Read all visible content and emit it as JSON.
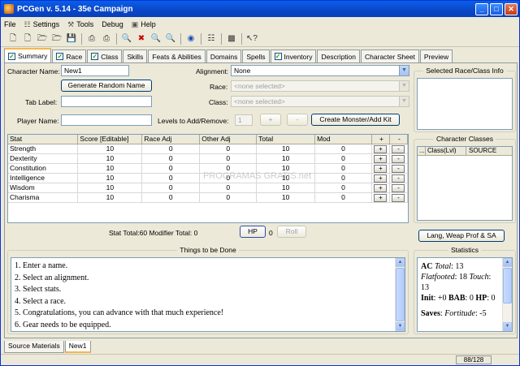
{
  "window": {
    "title": "PCGen v. 5.14 - 35e Campaign",
    "minimize": "_",
    "maximize": "□",
    "close": "✕"
  },
  "menu": [
    {
      "label": "File",
      "icon": ""
    },
    {
      "label": "Settings",
      "icon": "settings-icon"
    },
    {
      "label": "Tools",
      "icon": "tools-icon"
    },
    {
      "label": "Debug",
      "icon": ""
    },
    {
      "label": "Help",
      "icon": "help-icon"
    }
  ],
  "tabs": [
    {
      "label": "Summary",
      "checked": true
    },
    {
      "label": "Race",
      "checked": true
    },
    {
      "label": "Class",
      "checked": true
    },
    {
      "label": "Skills",
      "checked": false
    },
    {
      "label": "Feats & Abilities",
      "checked": false
    },
    {
      "label": "Domains",
      "checked": false
    },
    {
      "label": "Spells",
      "checked": false
    },
    {
      "label": "Inventory",
      "checked": true
    },
    {
      "label": "Description",
      "checked": false
    },
    {
      "label": "Character Sheet",
      "checked": false
    },
    {
      "label": "Preview",
      "checked": false
    }
  ],
  "summary": {
    "character_name_label": "Character Name:",
    "character_name": "New1",
    "random_name_button": "Generate Random Name",
    "tab_label_label": "Tab Label:",
    "tab_label": "",
    "player_name_label": "Player Name:",
    "player_name": "",
    "alignment_label": "Alignment:",
    "alignment": "None",
    "race_label": "Race:",
    "race": "<none selected>",
    "class_label": "Class:",
    "class": "<none selected>",
    "levels_label": "Levels to Add/Remove:",
    "levels": "1",
    "plus": "+",
    "minus": "-",
    "monster_button": "Create Monster/Add Kit"
  },
  "stats_table": {
    "headers": [
      "Stat",
      "Score [Editable]",
      "Race Adj",
      "Other Adj",
      "Total",
      "Mod",
      "+",
      "-"
    ],
    "rows": [
      {
        "stat": "Strength",
        "score": "10",
        "race": "0",
        "other": "0",
        "total": "10",
        "mod": "0"
      },
      {
        "stat": "Dexterity",
        "score": "10",
        "race": "0",
        "other": "0",
        "total": "10",
        "mod": "0"
      },
      {
        "stat": "Constitution",
        "score": "10",
        "race": "0",
        "other": "0",
        "total": "10",
        "mod": "0"
      },
      {
        "stat": "Intelligence",
        "score": "10",
        "race": "0",
        "other": "0",
        "total": "10",
        "mod": "0"
      },
      {
        "stat": "Wisdom",
        "score": "10",
        "race": "0",
        "other": "0",
        "total": "10",
        "mod": "0"
      },
      {
        "stat": "Charisma",
        "score": "10",
        "race": "0",
        "other": "0",
        "total": "10",
        "mod": "0"
      }
    ]
  },
  "watermark": "PROGRAMAS GRATIS.net",
  "totals": {
    "text": "Stat Total:60  Modifier Total: 0",
    "hp_button": "HP",
    "hp_value": "0",
    "roll_button": "Roll"
  },
  "lang_button": "Lang, Weap Prof & SA",
  "race_class_info": {
    "title": "Selected Race/Class Info"
  },
  "character_classes": {
    "title": "Character Classes",
    "col1": "Class(Lvl)",
    "col2": "SOURCE",
    "col0": "..."
  },
  "todo": {
    "title": "Things to be Done",
    "items": [
      "1. Enter a name.",
      "2. Select an alignment.",
      "3. Select stats.",
      "4. Select a race.",
      "5. Congratulations, you can advance with that much experience!",
      "6. Gear needs to be equipped."
    ]
  },
  "statistics": {
    "title": "Statistics",
    "ac_label": "AC",
    "ac_total_label": "Total",
    "ac_total": ": 13",
    "flat_label": "Flatfooted",
    "flat_value": ": 18",
    "touch_label": "Touch",
    "touch_value": ":",
    "touch_value2": "13",
    "init_label": "Init",
    "init_value": ": +0",
    "bab_label": "BAB",
    "bab_value": ": 0",
    "hp_label": "HP",
    "hp_value": ": 0",
    "saves_label": "Saves",
    "fort_label": "Fortitude",
    "fort_value": ": -5"
  },
  "bottom_tabs": [
    "Source Materials",
    "New1"
  ],
  "memory": "88/128"
}
